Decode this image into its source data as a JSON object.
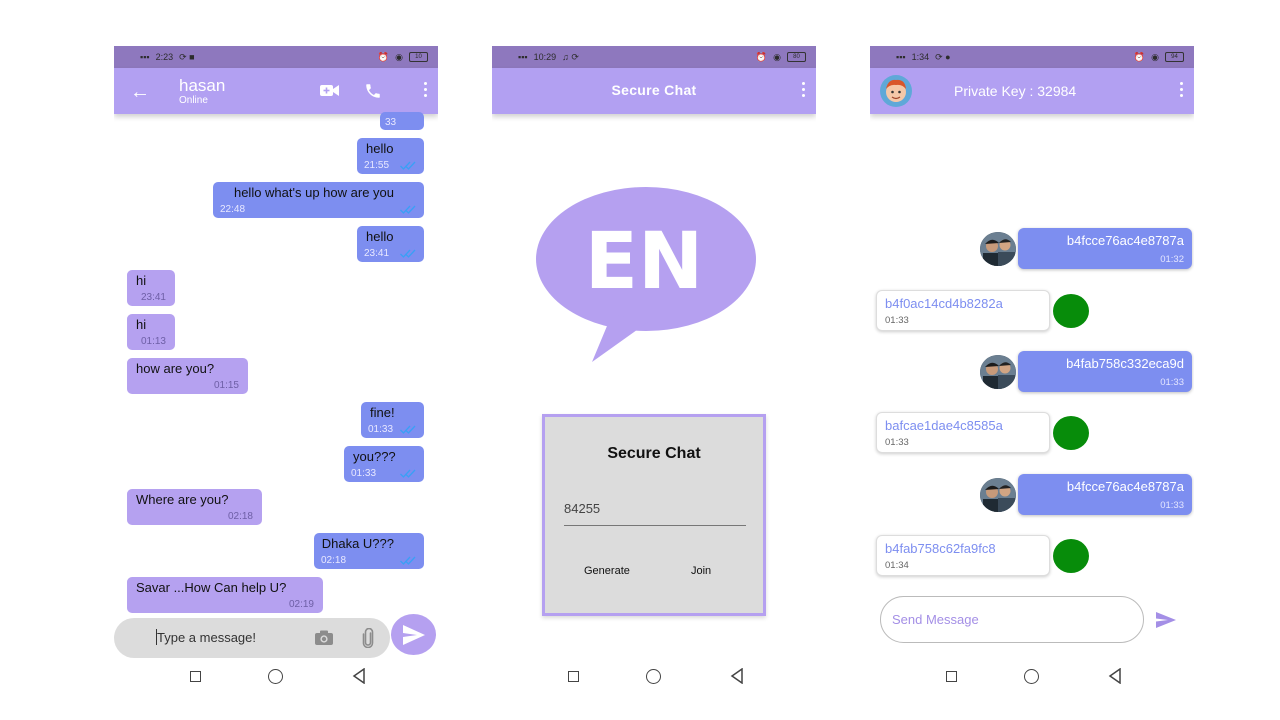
{
  "phone1": {
    "status": {
      "time": "2:23",
      "battery": "10"
    },
    "contact_name": "hasan",
    "contact_status": "Online",
    "input_placeholder": "Type a message!",
    "top_partial_time": "33",
    "messages": [
      {
        "text": "hello",
        "time": "21:55",
        "dir": "out"
      },
      {
        "text": "hello what's up how are you",
        "time": "22:48",
        "dir": "out"
      },
      {
        "text": "hello",
        "time": "23:41",
        "dir": "out"
      },
      {
        "text": "hi",
        "time": "23:41",
        "dir": "in"
      },
      {
        "text": "hi",
        "time": "01:13",
        "dir": "in"
      },
      {
        "text": "how are you?",
        "time": "01:15",
        "dir": "in"
      },
      {
        "text": "fine!",
        "time": "01:33",
        "dir": "out"
      },
      {
        "text": "you???",
        "time": "01:33",
        "dir": "out"
      },
      {
        "text": "Where are you?",
        "time": "02:18",
        "dir": "in"
      },
      {
        "text": "Dhaka U???",
        "time": "02:18",
        "dir": "out"
      },
      {
        "text": "Savar ...How Can help U?",
        "time": "02:19",
        "dir": "in"
      }
    ]
  },
  "phone2": {
    "status": {
      "time": "10:29",
      "battery": "80"
    },
    "title": "Secure Chat",
    "logo_text": "EN",
    "dialog": {
      "title": "Secure Chat",
      "code": "84255",
      "generate_label": "Generate",
      "join_label": "Join"
    }
  },
  "phone3": {
    "status": {
      "time": "1:34",
      "battery": "94"
    },
    "title": "Private Key : 32984",
    "send_placeholder": "Send Message",
    "messages": [
      {
        "hash": "b4fcce76ac4e8787a",
        "time": "01:32",
        "dir": "out"
      },
      {
        "hash": "b4f0ac14cd4b8282a",
        "time": "01:33",
        "dir": "in"
      },
      {
        "hash": "b4fab758c332eca9d",
        "time": "01:33",
        "dir": "out"
      },
      {
        "hash": "bafcae1dae4c8585a",
        "time": "01:33",
        "dir": "in"
      },
      {
        "hash": "b4fcce76ac4e8787a",
        "time": "01:33",
        "dir": "out"
      },
      {
        "hash": "b4fab758c62fa9fc8",
        "time": "01:34",
        "dir": "in"
      }
    ]
  },
  "colors": {
    "header": "#b2a0f2",
    "statusbar": "#8e78be",
    "outgoing": "#7d8ef0",
    "incoming": "#b5a1f0",
    "online_dot": "#078c0a"
  },
  "icons": [
    "back-arrow-icon",
    "video-call-icon",
    "phone-call-icon",
    "more-icon",
    "camera-icon",
    "attach-icon",
    "send-icon",
    "double-check-icon",
    "nav-recents-icon",
    "nav-home-icon",
    "nav-back-icon"
  ]
}
